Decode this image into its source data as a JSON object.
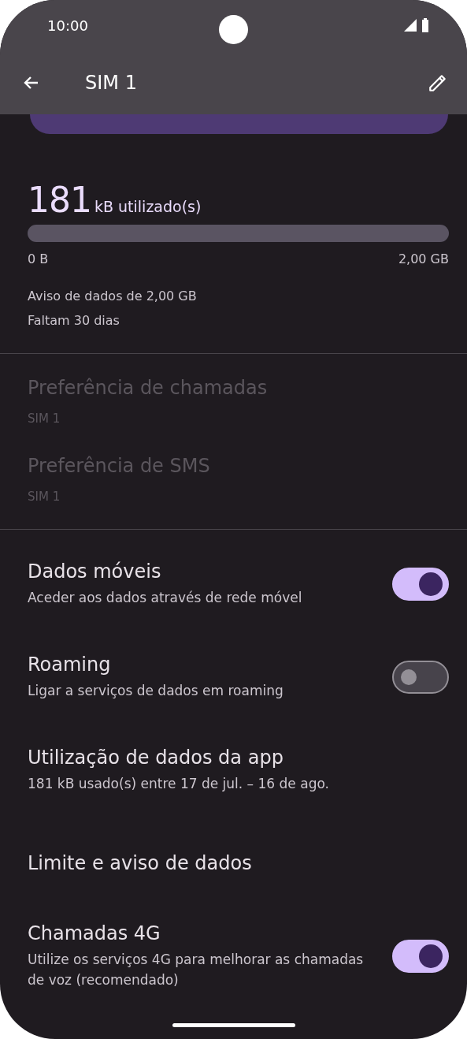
{
  "status_bar": {
    "time": "10:00"
  },
  "toolbar": {
    "title": "SIM 1"
  },
  "usage": {
    "amount": "181",
    "unit": "kB utilizado(s)",
    "min_label": "0 B",
    "max_label": "2,00 GB",
    "warning": "Aviso de dados de 2,00 GB",
    "remaining": "Faltam 30 dias"
  },
  "preferences": [
    {
      "title": "Preferência de chamadas",
      "summary": "SIM 1",
      "disabled": true
    },
    {
      "title": "Preferência de SMS",
      "summary": "SIM 1",
      "disabled": true
    }
  ],
  "settings": [
    {
      "kind": "switch",
      "title": "Dados móveis",
      "summary": "Aceder aos dados através de rede móvel",
      "on": true
    },
    {
      "kind": "switch",
      "title": "Roaming",
      "summary": "Ligar a serviços de dados em roaming",
      "on": false
    },
    {
      "kind": "link",
      "title": "Utilização de dados da app",
      "summary": "181 kB usado(s) entre 17 de jul. – 16 de ago."
    },
    {
      "kind": "link",
      "title": "Limite e aviso de dados"
    },
    {
      "kind": "switch",
      "title": "Chamadas 4G",
      "summary": "Utilize os serviços 4G para melhorar as chamadas de voz (recomendado)",
      "on": true
    }
  ]
}
